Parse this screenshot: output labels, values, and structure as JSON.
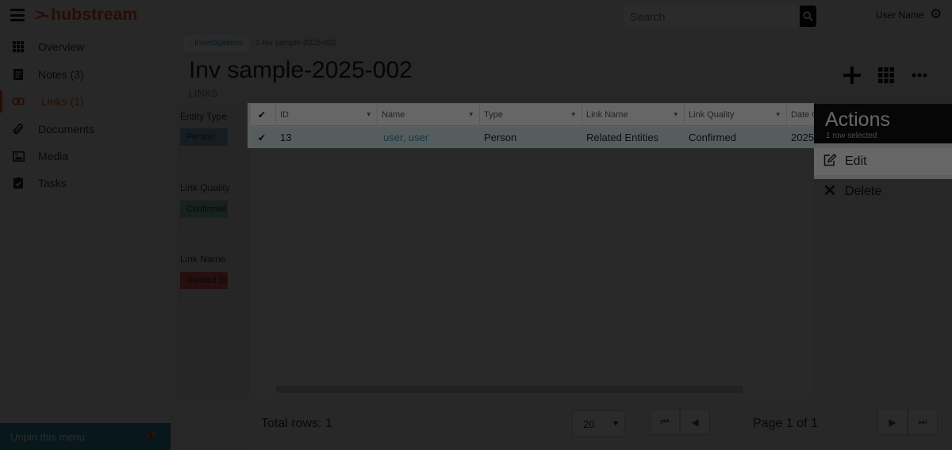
{
  "header": {
    "logo_text": "hubstream",
    "search_placeholder": "Search",
    "user_name": "User Name"
  },
  "sidebar": {
    "items": [
      {
        "label": "Overview",
        "icon": "grid-icon"
      },
      {
        "label": "Notes (3)",
        "icon": "note-icon"
      },
      {
        "label": "Links (1)",
        "icon": "link-icon",
        "active": true
      },
      {
        "label": "Documents",
        "icon": "paperclip-icon"
      },
      {
        "label": "Media",
        "icon": "image-icon"
      },
      {
        "label": "Tasks",
        "icon": "task-icon"
      }
    ],
    "unpin_label": "Unpin this menu"
  },
  "breadcrumb": {
    "items": [
      "Investigations",
      "1 Inv sample-2025-002"
    ]
  },
  "page": {
    "title": "Inv sample-2025-002",
    "subtitle": "LINKS"
  },
  "filters": [
    {
      "label": "Entity Type",
      "chip": "Person",
      "color": "#7fb2ce"
    },
    {
      "label": "Link Quality",
      "chip": "Confirmed",
      "color": "#8cc5b2"
    },
    {
      "label": "Link Name",
      "chip": "Related En",
      "color": "#e85a5a"
    }
  ],
  "grid": {
    "columns": [
      "ID",
      "Name",
      "Type",
      "Link Name",
      "Link Quality",
      "Date C"
    ],
    "rows": [
      {
        "id": "13",
        "name": "user, user",
        "type": "Person",
        "link_name": "Related Entities",
        "link_quality": "Confirmed",
        "date": "2025"
      }
    ]
  },
  "footer": {
    "total_rows": "Total rows: 1",
    "per_page": "20",
    "page_info": "Page 1 of 1"
  },
  "actions": {
    "title": "Actions",
    "subtitle": "1 row selected",
    "items": [
      {
        "label": "Edit",
        "icon": "edit-icon"
      },
      {
        "label": "Delete",
        "icon": "close-icon"
      }
    ]
  },
  "colors": {
    "brand": "#e8501e",
    "accent": "#2d8aa5",
    "selected_row": "#d8e8ec"
  }
}
